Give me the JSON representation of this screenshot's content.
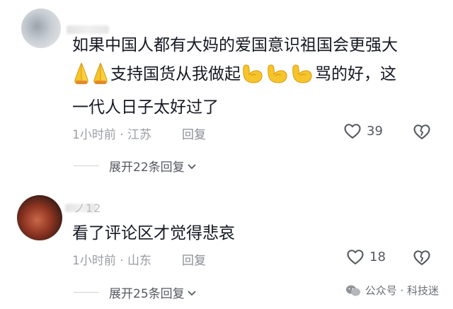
{
  "comments": [
    {
      "text_line1": "如果中国人都有大妈的爱国意识祖国会更强大",
      "text_line2_mid": "支持国货从我做起",
      "text_line2_end": "骂的好，这",
      "text_line3": "一代人日子太好过了",
      "emoji_before": "folded-hands",
      "emoji_after": "flexed-biceps",
      "time_location": "1小时前 · 江苏",
      "reply_label": "回复",
      "likes": "39",
      "expand_label": "展开22条回复"
    },
    {
      "username_fragment": "ノ12",
      "text": "看了评论区才觉得悲哀",
      "time_location": "1小时前 · 山东",
      "reply_label": "回复",
      "likes": "18",
      "expand_label": "展开25条回复"
    }
  ],
  "watermark": {
    "text": "公众号 · 科技迷"
  },
  "colors": {
    "text_primary": "#161823",
    "text_meta": "#9a9da4",
    "emoji_yellow": "#f6c42b"
  }
}
